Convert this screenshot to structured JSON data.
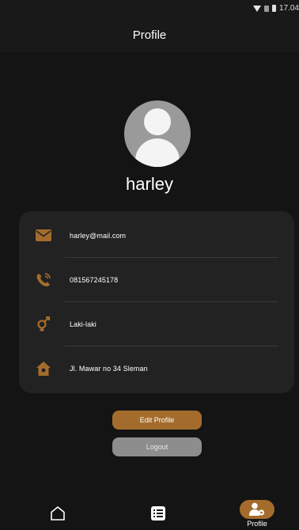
{
  "status_bar": {
    "time": "17.04"
  },
  "app_bar": {
    "title": "Profile"
  },
  "profile": {
    "username": "harley",
    "email": "harley@mail.com",
    "phone": "081567245178",
    "gender": "Laki-laki",
    "address": "Jl. Mawar no 34 Sleman"
  },
  "actions": {
    "edit_label": "Edit Profile",
    "logout_label": "Logout"
  },
  "nav": {
    "profile_label": "Profile"
  },
  "colors": {
    "accent": "#a46c2c",
    "background": "#141414",
    "card": "#222222",
    "button_gray": "#8d8d8d"
  },
  "icons": [
    "wifi-icon",
    "sim-icon",
    "battery-icon",
    "mail-icon",
    "phone-icon",
    "gender-icon",
    "home-address-icon",
    "home-nav-icon",
    "list-nav-icon",
    "profile-nav-icon"
  ]
}
